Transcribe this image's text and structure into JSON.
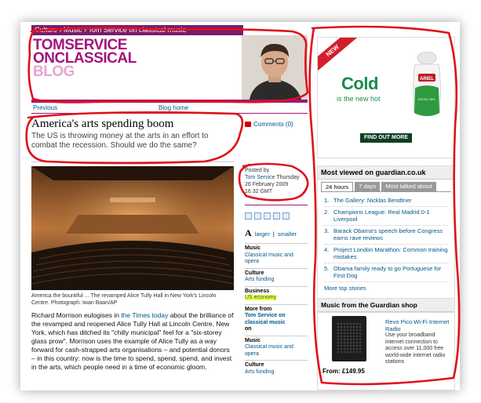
{
  "breadcrumb": {
    "items": [
      "Culture",
      "Music",
      "Tom Service on classical music"
    ]
  },
  "masthead": {
    "line1": "TOMSERVICE",
    "line2": "ONCLASSICAL",
    "line3": "BLOG"
  },
  "subnav": {
    "previous": "Previous",
    "blog_home": "Blog home"
  },
  "article": {
    "headline": "America's arts spending boom",
    "standfirst": "The US is throwing money at the arts in an effort to combat the recession. Should we do the same?",
    "comments": "Comments (0)",
    "caption": "America the bountiful ... The revamped Alice Tully Hall in New York's Lincoln Centre. Photograph: Iwan Baan/AP",
    "body_before_link": "Richard Morrison eulogises in ",
    "body_link": "the Times today",
    "body_after_link": " about the brilliance of the revamped and reopened Alice Tully Hall at Lincoln Centre, New York, which has ditched its \"chilly municipal\" feel for a \"six-storey glass prow\". Morrison uses the example of Alice Tully as a way forward for cash-strapped arts organisations – and potential donors – in this country: now is the time to spend, spend, spend, and invest in the arts, which people need in a time of economic gloom."
  },
  "meta": {
    "posted_by_label": "Posted by",
    "author": "Tom Service",
    "day": "Thursday",
    "date": "26 February 2009",
    "time": "16.32 GMT"
  },
  "font_size": {
    "larger": "larger",
    "separator": "|",
    "smaller": "smaller"
  },
  "tags": [
    {
      "heading": "Music",
      "link": "Classical music and opera"
    },
    {
      "heading": "Culture",
      "link": "Arts funding"
    },
    {
      "heading": "Business",
      "link": "US economy"
    }
  ],
  "more_from": {
    "prefix": "More from ",
    "link": "Tom Service on classical music",
    "suffix": " on"
  },
  "more_tags": [
    {
      "heading": "Music",
      "link": "Classical music and opera"
    },
    {
      "heading": "Culture",
      "link": "Arts funding"
    }
  ],
  "ad": {
    "badge": "NEW",
    "headline": "Cold",
    "tagline": "is the new hot",
    "button": "FIND OUT MORE",
    "brand": "ARIEL",
    "product": "EXCEL GEL"
  },
  "most_viewed": {
    "title": "Most viewed on guardian.co.uk",
    "tabs": [
      "24 hours",
      "7 days",
      "Most talked about"
    ],
    "items": [
      {
        "n": "1.",
        "text": "The Gallery: Nicklas Bendtner"
      },
      {
        "n": "2.",
        "text": "Champions League: Real Madrid 0-1 Liverpool"
      },
      {
        "n": "3.",
        "text": "Barack Obama's speech before Congress earns rave reviews"
      },
      {
        "n": "4.",
        "text": "Project London Marathon: Common training mistakes"
      },
      {
        "n": "5.",
        "text": "Obama family ready to go Portuguese for First Dog"
      }
    ],
    "more": "More top stories"
  },
  "shop": {
    "title": "Music from the Guardian shop",
    "product": "Revo Pico Wi-Fi Internet Radio",
    "description": "Use your broadband internet connection to access over 11,000 free world-wide internet radio stations",
    "price": "From: £149.95"
  },
  "colors": {
    "accent": "#a3157c",
    "link": "#005689",
    "annotation": "#e0101a",
    "highlight": "#ffff3a"
  }
}
